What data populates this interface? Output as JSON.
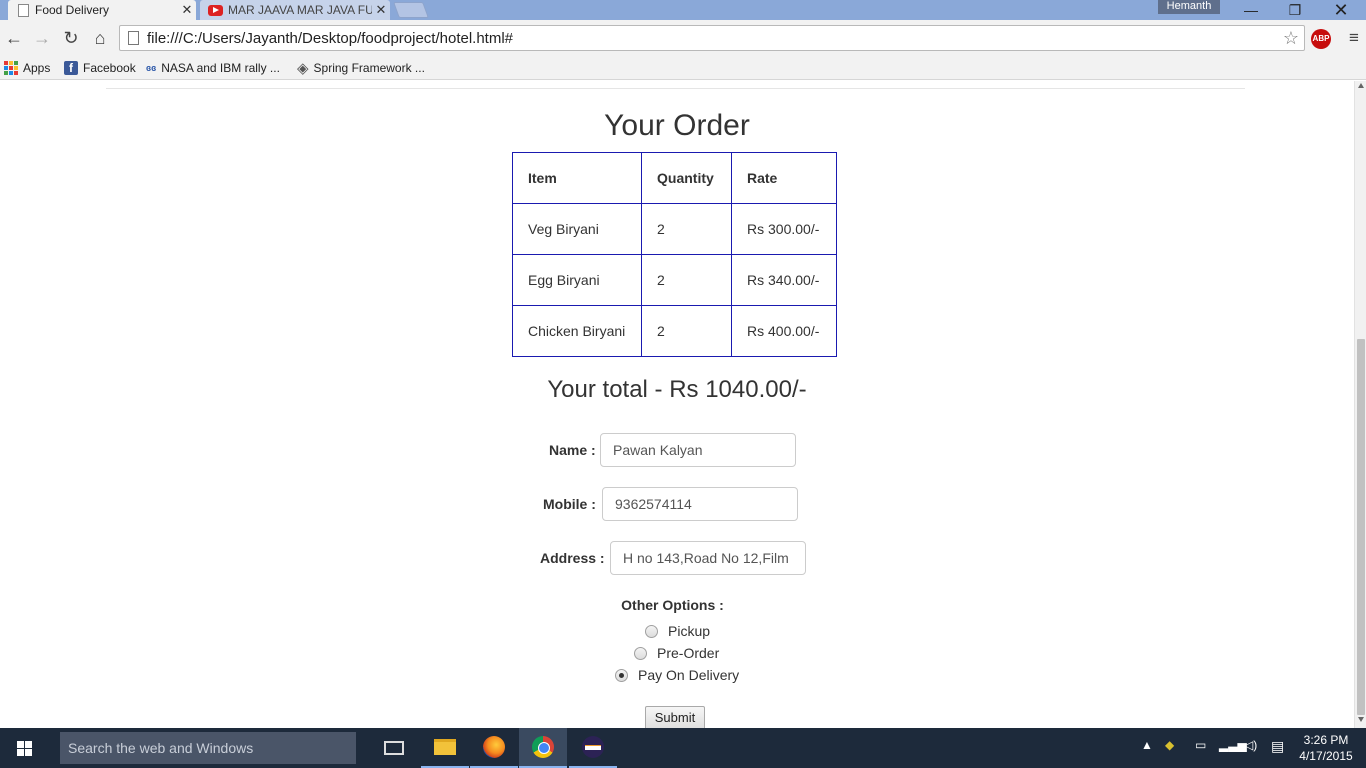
{
  "browser": {
    "tabs": [
      {
        "title": "Food Delivery",
        "active": true
      },
      {
        "title": "MAR JAAVA MAR JAVA FU",
        "active": false
      }
    ],
    "profile_name": "Hemanth",
    "url": "file:///C:/Users/Jayanth/Desktop/foodproject/hotel.html#",
    "bookmarks": [
      {
        "label": "Apps",
        "icon": "apps-grid-icon"
      },
      {
        "label": "Facebook",
        "icon": "facebook-icon"
      },
      {
        "label": "NASA and IBM rally ...",
        "icon": "nasa-icon"
      },
      {
        "label": "Spring Framework ...",
        "icon": "spring-icon"
      }
    ],
    "extension_badge": "ABP"
  },
  "page": {
    "heading": "Your Order",
    "table": {
      "headers": [
        "Item",
        "Quantity",
        "Rate"
      ],
      "rows": [
        [
          "Veg Biryani",
          "2",
          "Rs 300.00/-"
        ],
        [
          "Egg Biryani",
          "2",
          "Rs 340.00/-"
        ],
        [
          "Chicken Biryani",
          "2",
          "Rs 400.00/-"
        ]
      ]
    },
    "total_text": "Your total - Rs 1040.00/-",
    "form": {
      "name_label": "Name :",
      "name_value": "Pawan Kalyan",
      "mobile_label": "Mobile :",
      "mobile_value": "9362574114",
      "address_label": "Address :",
      "address_value": "H no 143,Road No 12,Film",
      "options_label": "Other Options :",
      "options": [
        {
          "label": "Pickup",
          "checked": false
        },
        {
          "label": "Pre-Order",
          "checked": false
        },
        {
          "label": "Pay On Delivery",
          "checked": true
        }
      ],
      "submit_label": "Submit"
    }
  },
  "taskbar": {
    "search_placeholder": "Search the web and Windows",
    "clock_time": "3:26 PM",
    "clock_date": "4/17/2015"
  }
}
